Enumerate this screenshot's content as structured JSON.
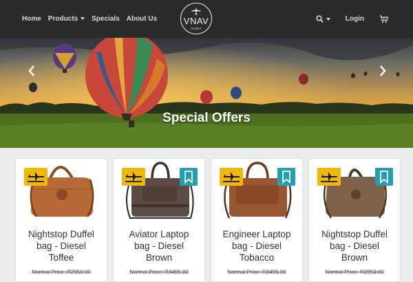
{
  "nav": {
    "links": [
      {
        "label": "Home"
      },
      {
        "label": "Products"
      },
      {
        "label": "Specials"
      },
      {
        "label": "About Us"
      }
    ],
    "logo": {
      "brand": "VNAV",
      "sub": "leather"
    },
    "login_label": "Login"
  },
  "hero": {
    "title": "Special Offers"
  },
  "products": [
    {
      "name_line1": "Nightstop Duffel",
      "name_line2": "bag - Diesel",
      "name_line3": "Toffee",
      "price": "Normal Price: R2950.00",
      "show_bookmark": false,
      "bag_color": "#b86a36"
    },
    {
      "name_line1": "Aviator Laptop",
      "name_line2": "bag - Diesel",
      "name_line3": "Brown",
      "price": "Normal Price: R3495.00",
      "show_bookmark": true,
      "bag_color": "#5c4c43"
    },
    {
      "name_line1": "Engineer Laptop",
      "name_line2": "bag - Diesel",
      "name_line3": "Tobacco",
      "price": "Normal Price: R3495.00",
      "show_bookmark": true,
      "bag_color": "#9a5533"
    },
    {
      "name_line1": "Nightstop Duffel",
      "name_line2": "bag - Diesel",
      "name_line3": "Brown",
      "price": "Normal Price: R2950.00",
      "show_bookmark": true,
      "bag_color": "#7f624a"
    }
  ],
  "colors": {
    "navbar": "#2b2b2b",
    "plane_badge": "#f0b909",
    "bookmark_badge": "#22a0b3"
  },
  "icons": [
    "plane-icon",
    "search-icon",
    "cart-icon",
    "chevron-left-icon",
    "chevron-right-icon",
    "bookmark-icon"
  ]
}
